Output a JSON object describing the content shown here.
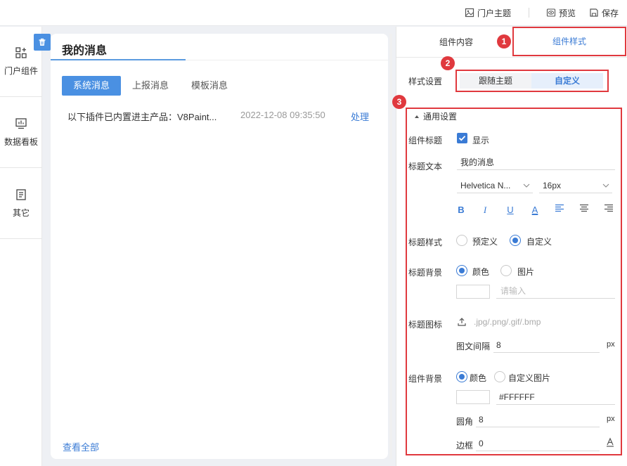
{
  "topbar": {
    "portal_theme": "门户主题",
    "preview": "预览",
    "save": "保存"
  },
  "leftnav": {
    "items": [
      {
        "label": "门户组件",
        "icon": "widgets-icon"
      },
      {
        "label": "数据看板",
        "icon": "dashboard-icon"
      },
      {
        "label": "其它",
        "icon": "document-icon"
      }
    ]
  },
  "widget": {
    "title": "我的消息",
    "tabs": [
      "系统消息",
      "上报消息",
      "模板消息"
    ],
    "active_tab": "系统消息",
    "messages": [
      {
        "text": "以下插件已内置进主产品：V8Paint...",
        "time": "2022-12-08 09:35:50",
        "action": "处理"
      }
    ],
    "view_all": "查看全部"
  },
  "panel": {
    "tabs": [
      "组件内容",
      "组件样式"
    ],
    "active_tab": "组件样式",
    "badges": [
      "1",
      "2",
      "3"
    ],
    "style_setting_label": "样式设置",
    "style_options": [
      "跟随主题",
      "自定义"
    ],
    "style_selected": "自定义",
    "section_title": "通用设置",
    "component_title_label": "组件标题",
    "show_label": "显示",
    "show_checked": true,
    "title_text_label": "标题文本",
    "title_text_value": "我的消息",
    "font_family": "Helvetica N...",
    "font_size": "16px",
    "format_icons": [
      "bold-icon",
      "italic-icon",
      "underline-icon",
      "font-color-icon",
      "align-left-icon",
      "align-center-icon",
      "align-right-icon"
    ],
    "title_style_label": "标题样式",
    "title_style_options": [
      "预定义",
      "自定义"
    ],
    "title_style_selected": "自定义",
    "title_bg_label": "标题背景",
    "title_bg_options": [
      "颜色",
      "图片"
    ],
    "title_bg_selected": "颜色",
    "title_bg_placeholder": "请输入",
    "title_icon_label": "标题图标",
    "title_icon_hint": ".jpg/.png/.gif/.bmp",
    "text_gap_label": "图文间隔",
    "text_gap_value": "8",
    "px": "px",
    "component_bg_label": "组件背景",
    "component_bg_options": [
      "颜色",
      "自定义图片"
    ],
    "component_bg_selected": "颜色",
    "component_bg_color": "#FFFFFF",
    "radius_label": "圆角",
    "radius_value": "8",
    "border_label": "边框",
    "border_value": "0"
  },
  "colors": {
    "accent": "#4a90e2",
    "link": "#3a7bd5",
    "highlight": "#e0393e"
  }
}
